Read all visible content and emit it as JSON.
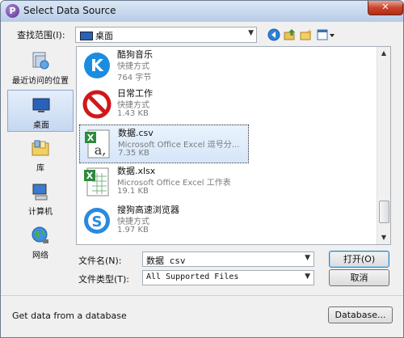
{
  "window": {
    "title": "Select Data Source",
    "close_glyph": "✕"
  },
  "toolbar": {
    "lookin_label": "查找范围(I):",
    "lookin_value": "桌面",
    "icons": [
      "back-icon",
      "up-folder-icon",
      "new-folder-icon",
      "views-menu-icon"
    ]
  },
  "places": [
    {
      "label": "最近访问的位置",
      "icon": "recent-places-icon"
    },
    {
      "label": "桌面",
      "icon": "desktop-icon"
    },
    {
      "label": "库",
      "icon": "libraries-icon"
    },
    {
      "label": "计算机",
      "icon": "computer-icon"
    },
    {
      "label": "网络",
      "icon": "network-icon"
    }
  ],
  "files": [
    {
      "name": "酷狗音乐",
      "type": "快捷方式",
      "size": "764 字节",
      "icon": "kugou-icon"
    },
    {
      "name": "日常工作",
      "type": "快捷方式",
      "size": "1.43 KB",
      "icon": "prohibited-icon"
    },
    {
      "name": "数据.csv",
      "type": "Microsoft Office Excel 逗号分...",
      "size": "7.35 KB",
      "icon": "csv-file-icon"
    },
    {
      "name": "数据.xlsx",
      "type": "Microsoft Office Excel 工作表",
      "size": "19.1 KB",
      "icon": "xlsx-file-icon"
    },
    {
      "name": "搜狗高速浏览器",
      "type": "快捷方式",
      "size": "1.97 KB",
      "icon": "sogou-browser-icon"
    }
  ],
  "filename": {
    "label": "文件名(N):",
    "value": "数据 csv"
  },
  "filetype": {
    "label": "文件类型(T):",
    "value": "All Supported Files"
  },
  "buttons": {
    "open": "打开(O)",
    "cancel": "取消",
    "database": "Database..."
  },
  "status": "Get data from a database",
  "colors": {
    "selection": "#d5e6f9",
    "titlebar": "#b7cbe6",
    "close": "#c8452e"
  }
}
